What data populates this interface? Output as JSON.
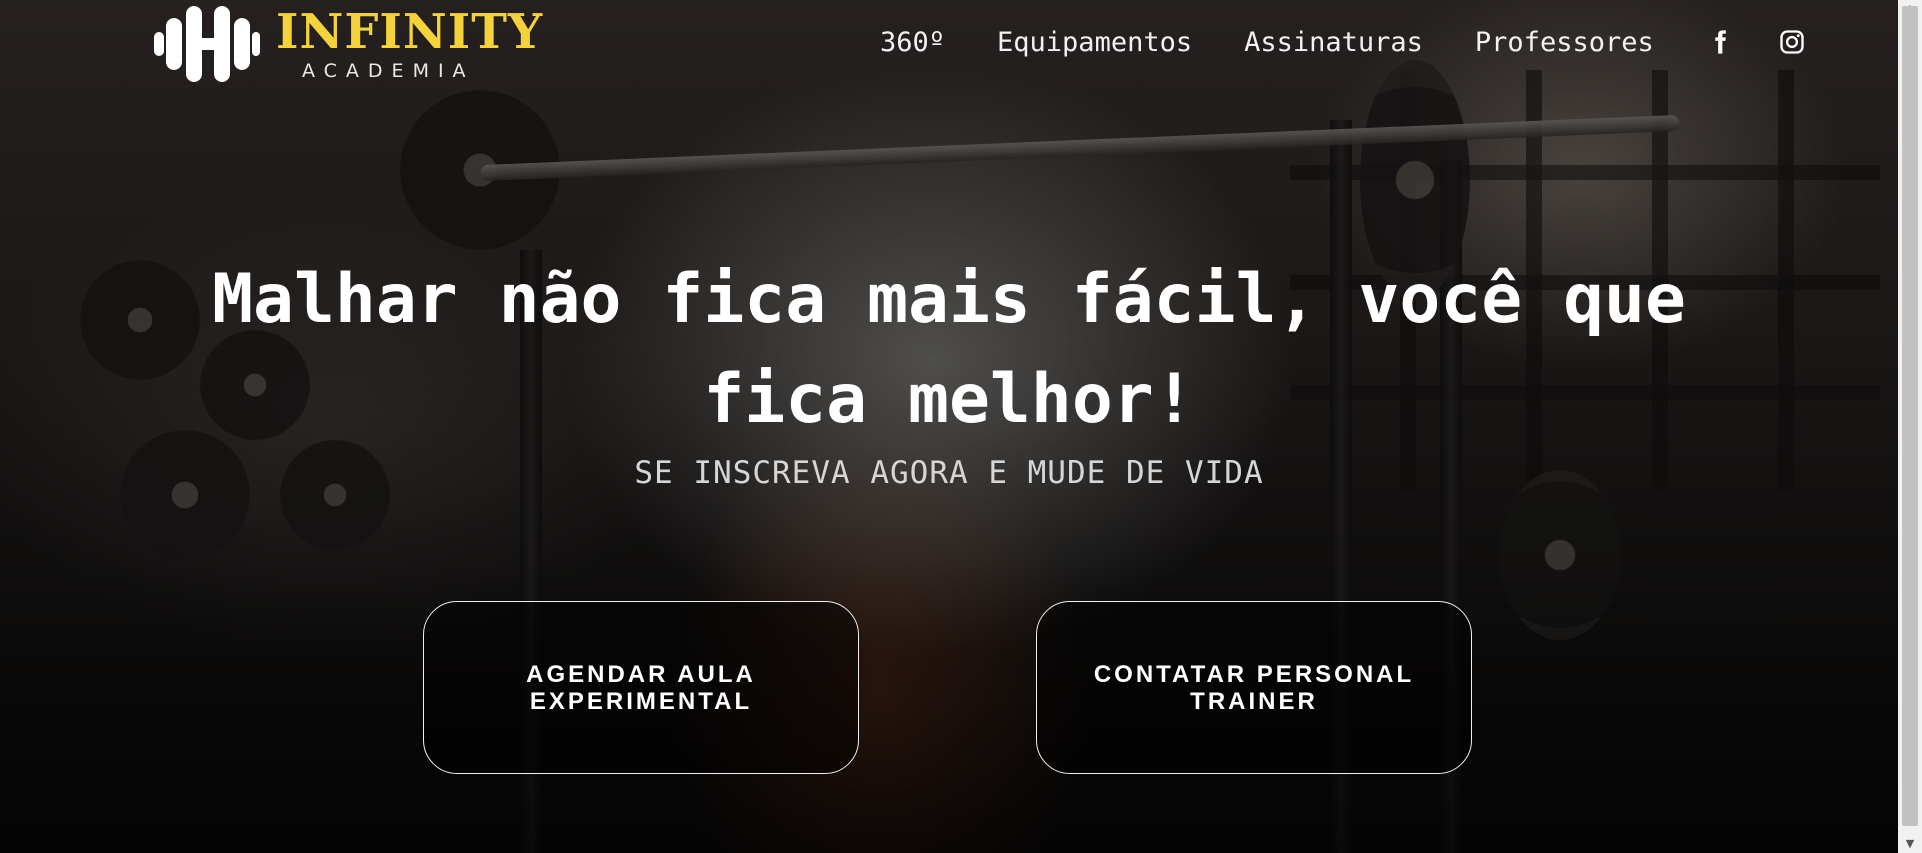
{
  "brand": {
    "name": "INFINITY",
    "tagline": "ACADEMIA",
    "accent_color": "#f3d23b",
    "icon": "dumbbell-h-icon"
  },
  "nav": {
    "items": [
      {
        "label": "360º"
      },
      {
        "label": "Equipamentos"
      },
      {
        "label": "Assinaturas"
      },
      {
        "label": "Professores"
      }
    ],
    "social": [
      {
        "icon": "facebook-icon"
      },
      {
        "icon": "instagram-icon"
      }
    ]
  },
  "hero": {
    "title": "Malhar não fica mais fácil, você que fica melhor!",
    "subtitle": "SE INSCREVA AGORA E MUDE DE VIDA",
    "buttons": [
      {
        "label": "AGENDAR AULA EXPERIMENTAL"
      },
      {
        "label": "CONTATAR PERSONAL TRAINER"
      }
    ]
  },
  "scrollbar": {
    "up_arrow": "▲",
    "down_arrow": "▼"
  }
}
